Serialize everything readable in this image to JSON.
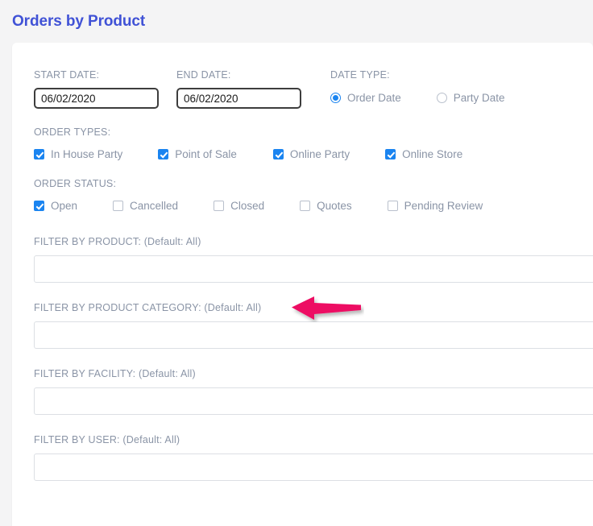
{
  "page": {
    "title": "Orders by Product"
  },
  "form": {
    "start_date": {
      "label": "START DATE:",
      "value": "06/02/2020"
    },
    "end_date": {
      "label": "END DATE:",
      "value": "06/02/2020"
    },
    "date_type": {
      "label": "DATE TYPE:",
      "options": [
        {
          "label": "Order Date",
          "selected": true
        },
        {
          "label": "Party Date",
          "selected": false
        }
      ]
    },
    "order_types": {
      "label": "ORDER TYPES:",
      "options": [
        {
          "label": "In House Party",
          "checked": true
        },
        {
          "label": "Point of Sale",
          "checked": true
        },
        {
          "label": "Online Party",
          "checked": true
        },
        {
          "label": "Online Store",
          "checked": true
        }
      ]
    },
    "order_status": {
      "label": "ORDER STATUS:",
      "options": [
        {
          "label": "Open",
          "checked": true
        },
        {
          "label": "Cancelled",
          "checked": false
        },
        {
          "label": "Closed",
          "checked": false
        },
        {
          "label": "Quotes",
          "checked": false
        },
        {
          "label": "Pending Review",
          "checked": false
        }
      ]
    },
    "filters": [
      {
        "label": "FILTER BY PRODUCT: (Default: All)",
        "value": ""
      },
      {
        "label": "FILTER BY PRODUCT CATEGORY: (Default: All)",
        "value": ""
      },
      {
        "label": "FILTER BY FACILITY: (Default: All)",
        "value": ""
      },
      {
        "label": "FILTER BY USER: (Default: All)",
        "value": ""
      }
    ]
  },
  "annotation": {
    "arrow_color": "#ed1164",
    "arrow_direction": "left",
    "points_at": "FILTER BY PRODUCT CATEGORY: (Default: All)"
  },
  "colors": {
    "title": "#4052d6",
    "label": "#8a94a6",
    "accent": "#1a84f0",
    "page_background": "#f4f4f5",
    "card_background": "#ffffff"
  }
}
